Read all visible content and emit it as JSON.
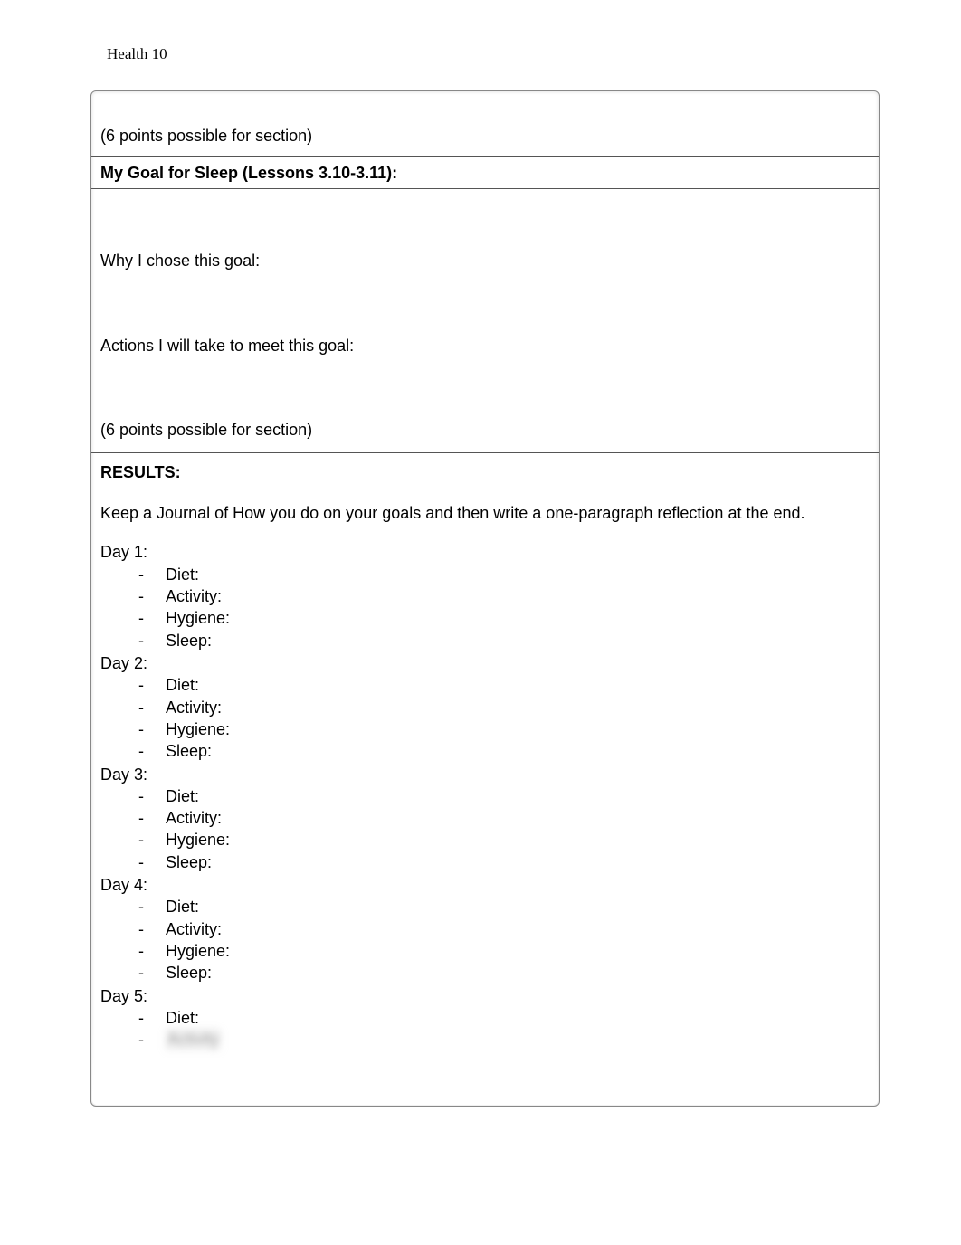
{
  "header": "Health 10",
  "section_points_a": "(6 points possible for section)",
  "goal_heading": "My Goal for Sleep (Lessons 3.10-3.11):",
  "why_label": "Why I chose this goal:",
  "actions_label": "Actions I will take to meet this goal:",
  "section_points_b": "(6 points possible for section)",
  "results_heading": "RESULTS:",
  "results_intro": "Keep a Journal of How you do on your goals and then write a one-paragraph reflection at the end.",
  "days": [
    {
      "label": "Day 1:",
      "items": [
        "Diet:",
        "Activity:",
        "Hygiene:",
        "Sleep:"
      ]
    },
    {
      "label": "Day 2:",
      "items": [
        "Diet:",
        "Activity:",
        "Hygiene:",
        "Sleep:"
      ]
    },
    {
      "label": "Day 3:",
      "items": [
        "Diet:",
        "Activity:",
        "Hygiene:",
        "Sleep:"
      ]
    },
    {
      "label": "Day 4:",
      "items": [
        "Diet:",
        "Activity:",
        "Hygiene:",
        "Sleep:"
      ]
    },
    {
      "label": "Day 5:",
      "items": [
        "Diet:"
      ],
      "blurred_item": "Activity"
    }
  ]
}
